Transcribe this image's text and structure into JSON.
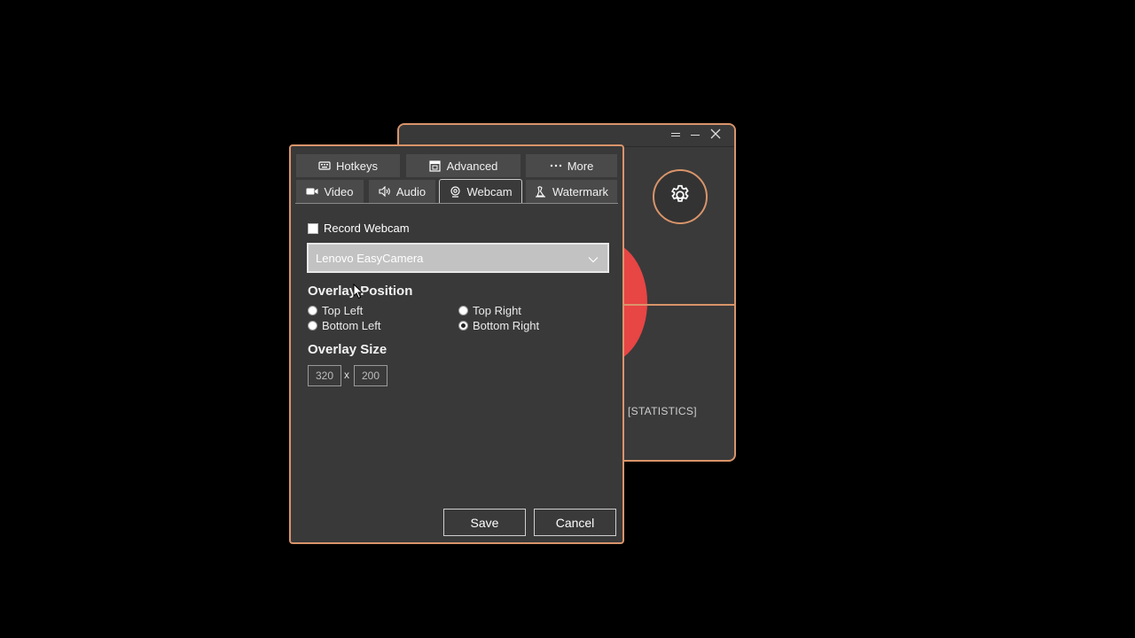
{
  "main_window": {
    "titlebar_buttons": [
      "menu-icon",
      "minimize-icon",
      "close-icon"
    ],
    "settings_icon": "gear-icon",
    "stats_label": "[STATISTICS]",
    "record_color": "#e84545"
  },
  "settings": {
    "tabs_row1": [
      {
        "label": "Hotkeys",
        "icon": "keyboard-icon"
      },
      {
        "label": "Advanced",
        "icon": "window-icon"
      },
      {
        "label": "More",
        "icon": "ellipsis-icon"
      }
    ],
    "tabs_row2": [
      {
        "label": "Video",
        "icon": "video-camera-icon"
      },
      {
        "label": "Audio",
        "icon": "speaker-icon"
      },
      {
        "label": "Webcam",
        "icon": "webcam-icon",
        "active": true
      },
      {
        "label": "Watermark",
        "icon": "stamp-icon"
      }
    ],
    "record_webcam_label": "Record Webcam",
    "record_webcam_checked": false,
    "camera_select_value": "Lenovo EasyCamera",
    "overlay_position_title": "Overlay Position",
    "positions": {
      "top_left": "Top Left",
      "top_right": "Top Right",
      "bottom_left": "Bottom Left",
      "bottom_right": "Bottom Right"
    },
    "selected_position": "Bottom Right",
    "overlay_size_title": "Overlay Size",
    "width_value": "320",
    "size_separator": "x",
    "height_value": "200",
    "save_label": "Save",
    "cancel_label": "Cancel"
  },
  "colors": {
    "accent": "#d9946a",
    "window_bg": "#393939"
  }
}
